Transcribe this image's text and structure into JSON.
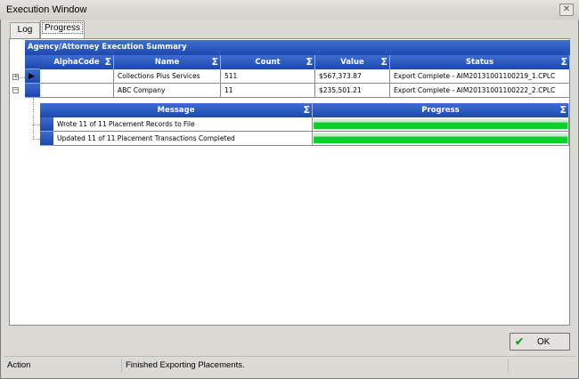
{
  "window": {
    "title": "Execution Window",
    "close_icon": "close-icon"
  },
  "tabs": [
    {
      "label": "Log",
      "active": false
    },
    {
      "label": "Progress",
      "active": true
    }
  ],
  "summary_grid": {
    "caption": "Agency/Attorney Execution Summary",
    "columns": [
      "AlphaCode",
      "Name",
      "Count",
      "Value",
      "Status"
    ],
    "rows": [
      {
        "alphacode": "",
        "name": "Collections Plus Services",
        "count": "511",
        "value": "$567,373.87",
        "status": "Export Complete - AIM20131001100219_1.CPLC",
        "expanded": false,
        "current": true
      },
      {
        "alphacode": "",
        "name": "ABC Company",
        "count": "11",
        "value": "$235,501.21",
        "status": "Export Complete - AIM20131001100222_2.CPLC",
        "expanded": true,
        "current": false
      }
    ]
  },
  "detail_grid": {
    "columns": [
      "Message",
      "Progress"
    ],
    "rows": [
      {
        "message": "Wrote 11 of 11 Placement Records to File",
        "progress": 100
      },
      {
        "message": "Updated 11 of 11 Placement Transactions Completed",
        "progress": 100
      }
    ]
  },
  "ok_button": {
    "label": "OK",
    "icon": "checkmark-icon"
  },
  "status_bar": {
    "label": "Action",
    "message": "Finished Exporting Placements."
  },
  "colors": {
    "header": "#1e49b0",
    "progress": "#0ad22a"
  }
}
